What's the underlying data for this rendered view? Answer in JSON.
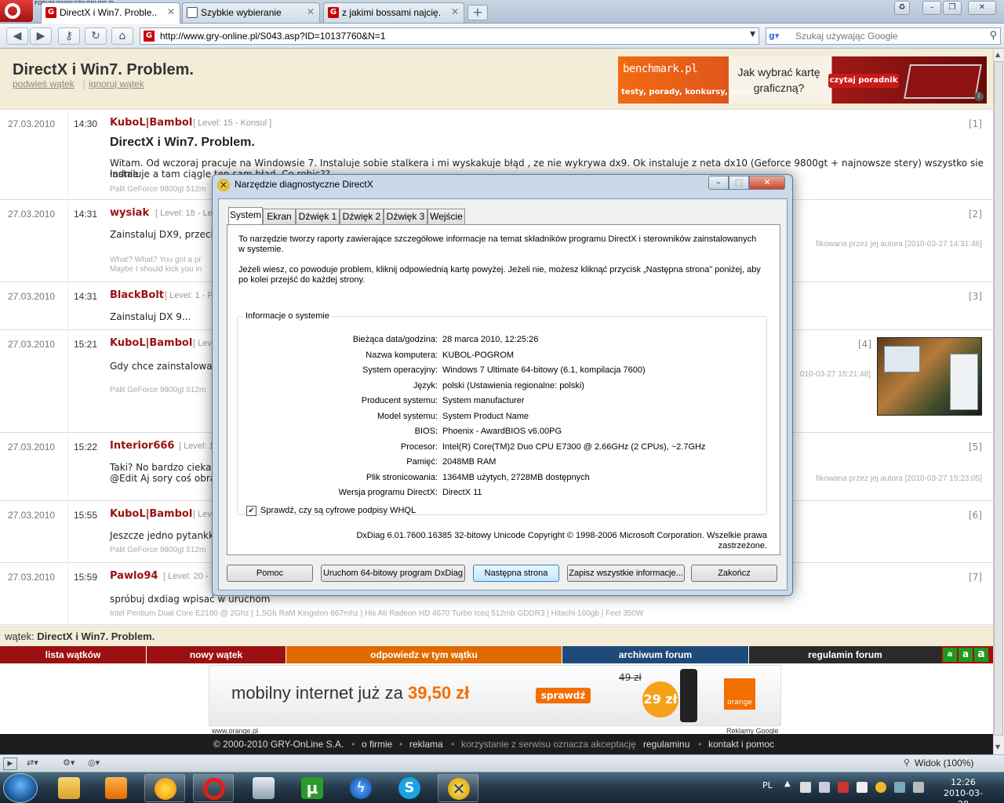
{
  "browser": {
    "site_badge": "FORUM WWW.GRY-ONLINE.PL",
    "tabs": [
      {
        "label": "DirectX i Win7. Proble..."
      },
      {
        "label": "Szybkie wybieranie"
      },
      {
        "label": "z jakimi bossami najcię..."
      }
    ],
    "url": "http://www.gry-online.pl/S043.asp?ID=10137760&N=1",
    "search_placeholder": "Szukaj używając Google",
    "zoom_label": "Widok (100%)"
  },
  "thread": {
    "title": "DirectX i Win7. Problem.",
    "link_promote": "podwieś wątek",
    "link_ignore": "ignoruj wątek",
    "separator": "|"
  },
  "banner": {
    "brand": "benchmark.pl",
    "tagline": "testy, porady, konkursy, newsy",
    "question": "Jak wybrać kartę graficzną?",
    "button": "czytaj poradnik"
  },
  "posts": [
    {
      "date": "27.03.2010",
      "time": "14:30",
      "author": "KuboL|Bambol",
      "level": "[ Level: 15 - Konsul ]",
      "num": "[1]",
      "title": "DirectX i Win7. Problem.",
      "body": [
        "Witam. Od wczoraj pracuje na Windowsie 7. Instaluje sobie stalkera i mi wyskakuje błąd , ze nie wykrywa dx9. Ok instaluje z neta dx10 (Geforce 9800gt + najnowsze stery) wszystko sie ładnie",
        "instaluje a tam ciągle ten sam błąd. Co robic??"
      ],
      "sig": "Palit GeForce 9800gt 512m",
      "edit": ""
    },
    {
      "date": "27.03.2010",
      "time": "14:31",
      "author": "wysiak",
      "level": "[ Level: 18 - Le",
      "num": "[2]",
      "title": "",
      "body": [
        "Zainstaluj DX9, przecie"
      ],
      "sig": "What? What? You got a pr",
      "sig2": "Maybe I should kick you in",
      "edit": "fikowana przez jej autora [2010-03-27 14:31:46]"
    },
    {
      "date": "27.03.2010",
      "time": "14:31",
      "author": "BlackBolt",
      "level": "[ Level: 1 - P",
      "num": "[3]",
      "title": "",
      "body": [
        "Zainstaluj DX 9..."
      ],
      "sig": "",
      "edit": ""
    },
    {
      "date": "27.03.2010",
      "time": "15:21",
      "author": "KuboL|Bambol",
      "level": "[ Lev",
      "num": "[4]",
      "title": "",
      "body": [
        "Gdy chce zainstalować"
      ],
      "sig": "Palit GeForce 9800gt 512m",
      "edit": "010-03-27 15:21:48]"
    },
    {
      "date": "27.03.2010",
      "time": "15:22",
      "author": "Interior666",
      "level": "[ Level: 1",
      "num": "[5]",
      "title": "",
      "body": [
        "Taki? No bardzo cieka",
        "@Edit Aj sory coś obra"
      ],
      "sig": "",
      "edit": "fikowana przez jej autora [2010-03-27 15:23:05]"
    },
    {
      "date": "27.03.2010",
      "time": "15:55",
      "author": "KuboL|Bambol",
      "level": "[ Lev",
      "num": "[6]",
      "title": "",
      "body": [
        "Jeszcze jedno pytankk"
      ],
      "sig": "Palit GeForce 9800gt 512m",
      "edit": ""
    },
    {
      "date": "27.03.2010",
      "time": "15:59",
      "author": "Pawlo94",
      "level": "[ Level: 20 -",
      "num": "[7]",
      "title": "",
      "body": [
        "spróbuj dxdiag wpisać w uruchom"
      ],
      "sig": "Intel Pentium Dual Core E2180 @ 2Ghz | 1,5Gb RaM Kingston 667mhz | His Ati Radeon HD 4670 Turbo Iceq 512mb GDDR3 | Hitachi 160gb | Feel 350W",
      "edit": ""
    }
  ],
  "thread_bar": {
    "prefix": "wątek:",
    "title": "DirectX i Win7. Problem."
  },
  "menu": {
    "items": [
      "lista wątków",
      "nowy wątek",
      "odpowiedz w tym wątku",
      "archiwum forum",
      "regulamin forum"
    ],
    "colors": [
      "#9b1010",
      "#9b1010",
      "#e06a00",
      "#1e4a7a",
      "#2a2a2a"
    ],
    "text_size": [
      "a",
      "a",
      "a"
    ]
  },
  "ad": {
    "text": "mobilny internet już za",
    "price": "39,50 zł",
    "button": "sprawdź",
    "old_price": "49 zł",
    "new_price": "29 zł",
    "brand": "orange",
    "link_left": "www.orange.pl",
    "link_right": "Reklamy Google"
  },
  "footer": {
    "copyright": "© 2000-2010 GRY-OnLine S.A.",
    "about": "o firmie",
    "ads": "reklama",
    "terms_note": "korzystanie z serwisu oznacza akceptację",
    "rules": "regulaminu",
    "contact": "kontakt i pomoc",
    "dot": "•"
  },
  "dialog": {
    "title": "Narzędzie diagnostyczne DirectX",
    "tabs": [
      "System",
      "Ekran",
      "Dźwięk 1",
      "Dźwięk 2",
      "Dźwięk 3",
      "Wejście"
    ],
    "intro1": "To narzędzie tworzy raporty zawierające szczegółowe informacje na temat składników programu DirectX i sterowników zainstalowanych w systemie.",
    "intro2": "Jeżeli wiesz, co powoduje problem, kliknij odpowiednią kartę powyżej. Jeżeli nie, możesz kliknąć przycisk „Następna strona” poniżej, aby po kolei przejść do każdej strony.",
    "group_label": "Informacje o systemie",
    "rows": [
      {
        "k": "Bieżąca data/godzina:",
        "v": "28 marca 2010, 12:25:26"
      },
      {
        "k": "Nazwa komputera:",
        "v": "KUBOL-POGROM"
      },
      {
        "k": "System operacyjny:",
        "v": "Windows 7 Ultimate 64-bitowy (6.1, kompilacja 7600)"
      },
      {
        "k": "Język:",
        "v": "polski (Ustawienia regionalne: polski)"
      },
      {
        "k": "Producent systemu:",
        "v": "System manufacturer"
      },
      {
        "k": "Model systemu:",
        "v": "System Product Name"
      },
      {
        "k": "BIOS:",
        "v": "Phoenix - AwardBIOS v6.00PG"
      },
      {
        "k": "Procesor:",
        "v": "Intel(R) Core(TM)2 Duo CPU     E7300  @ 2.66GHz (2 CPUs), ~2.7GHz"
      },
      {
        "k": "Pamięć:",
        "v": "2048MB RAM"
      },
      {
        "k": "Plik stronicowania:",
        "v": "1364MB użytych, 2728MB dostępnych"
      },
      {
        "k": "Wersja programu DirectX:",
        "v": "DirectX 11"
      }
    ],
    "checkbox_label": "Sprawdź, czy są cyfrowe podpisy WHQL",
    "checkbox_checked": true,
    "version_line1": "DxDiag 6.01.7600.16385 32-bitowy Unicode  Copyright © 1998-2006 Microsoft Corporation. Wszelkie prawa",
    "version_line2": "zastrzeżone.",
    "buttons": [
      "Pomoc",
      "Uruchom 64-bitowy program DxDiag",
      "Następna strona",
      "Zapisz wszystkie informacje...",
      "Zakończ"
    ]
  },
  "taskbar": {
    "lang": "PL",
    "time": "12:26",
    "date": "2010-03-28"
  }
}
